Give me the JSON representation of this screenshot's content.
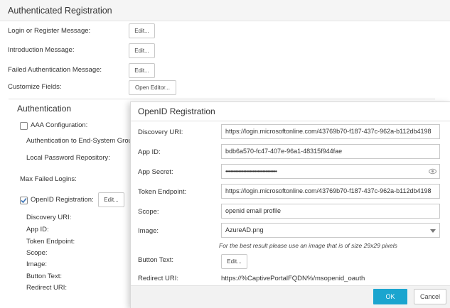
{
  "page": {
    "title": "Authenticated Registration",
    "rows": [
      {
        "label": "Login or Register Message:",
        "button": "Edit..."
      },
      {
        "label": "Introduction Message:",
        "button": "Edit..."
      },
      {
        "label": "Failed Authentication Message:",
        "button": "Edit..."
      },
      {
        "label": "Customize Fields:",
        "button": "Open Editor..."
      }
    ]
  },
  "auth": {
    "title": "Authentication",
    "aaa_label": "AAA Configuration:",
    "aaa_checked": false,
    "auth_to_esg": "Authentication to End-System Group",
    "local_pw": "Local Password Repository:",
    "max_failed": "Max Failed Logins:",
    "openid_label": "OpenID Registration:",
    "openid_checked": true,
    "openid_edit": "Edit...",
    "sub_labels": [
      "Discovery URI:",
      "App ID:",
      "Token Endpoint:",
      "Scope:",
      "Image:",
      "Button Text:",
      "Redirect URI:"
    ]
  },
  "modal": {
    "title": "OpenID Registration",
    "discovery_label": "Discovery URI:",
    "discovery_value": "https://login.microsoftonline.com/43769b70-f187-437c-962a-b112db4198",
    "appid_label": "App ID:",
    "appid_value": "bdb6a570-fc47-407e-96a1-48315f944fae",
    "secret_label": "App Secret:",
    "secret_value": "••••••••••••••••••••••••••••••••••••••••",
    "token_label": "Token Endpoint:",
    "token_value": "https://login.microsoftonline.com/43769b70-f187-437c-962a-b112db4198",
    "scope_label": "Scope:",
    "scope_value": "openid email profile",
    "image_label": "Image:",
    "image_value": "AzureAD.png",
    "image_hint": "For the best result please use an image that is of size 29x29 pixels",
    "button_text_label": "Button Text:",
    "button_text_edit": "Edit...",
    "redirect_label": "Redirect URI:",
    "redirect_value": "https://%CaptivePortalFQDN%/msopenid_oauth",
    "ok": "OK",
    "cancel": "Cancel"
  },
  "colors": {
    "ok_button": "#1ba5cf",
    "check_mark": "#3a73b7"
  }
}
